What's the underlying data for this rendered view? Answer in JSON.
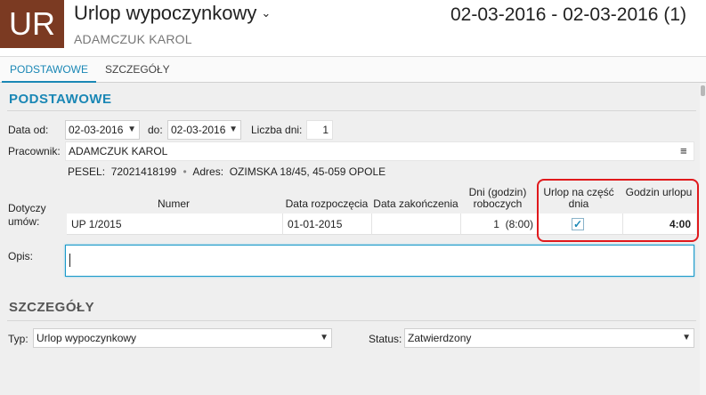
{
  "header": {
    "avatar_text": "UR",
    "title": "Urlop wypoczynkowy",
    "title_chevron": "⌄",
    "subtitle": "ADAMCZUK KAROL",
    "date_range": "02-03-2016 - 02-03-2016 (1)"
  },
  "tabs": [
    {
      "label": "PODSTAWOWE",
      "active": true
    },
    {
      "label": "SZCZEGÓŁY",
      "active": false
    }
  ],
  "basic": {
    "section_title": "PODSTAWOWE",
    "date_from_label": "Data od:",
    "date_from_value": "02-03-2016",
    "date_to_label": "do:",
    "date_to_value": "02-03-2016",
    "days_label": "Liczba dni:",
    "days_value": "1",
    "employee_label": "Pracownik:",
    "employee_value": "ADAMCZUK KAROL",
    "employee_menu_icon": "≡",
    "pesel_label": "PESEL:",
    "pesel_value": "72021418199",
    "separator": "•",
    "address_label": "Adres:",
    "address_value": "OZIMSKA 18/45, 45-059 OPOLE",
    "contracts_label": "Dotyczy umów:",
    "description_label": "Opis:",
    "description_value": ""
  },
  "contracts_table": {
    "columns": [
      "Numer",
      "Data rozpoczęcia",
      "Data zakończenia",
      "Dni (godzin) roboczych",
      "Urlop na część dnia",
      "Godzin urlopu"
    ],
    "rows": [
      {
        "numer": "UP 1/2015",
        "start": "01-01-2015",
        "end": "",
        "days_count": "1",
        "days_hours": "(8:00)",
        "partial_day": true,
        "hours": "4:00"
      }
    ]
  },
  "details": {
    "section_title": "SZCZEGÓŁY",
    "type_label": "Typ:",
    "type_value": "Urlop wypoczynkowy",
    "status_label": "Status:",
    "status_value": "Zatwierdzony"
  },
  "colors": {
    "accent": "#1a87b5",
    "avatar_bg": "#7b3a22",
    "highlight": "#e0191c"
  }
}
